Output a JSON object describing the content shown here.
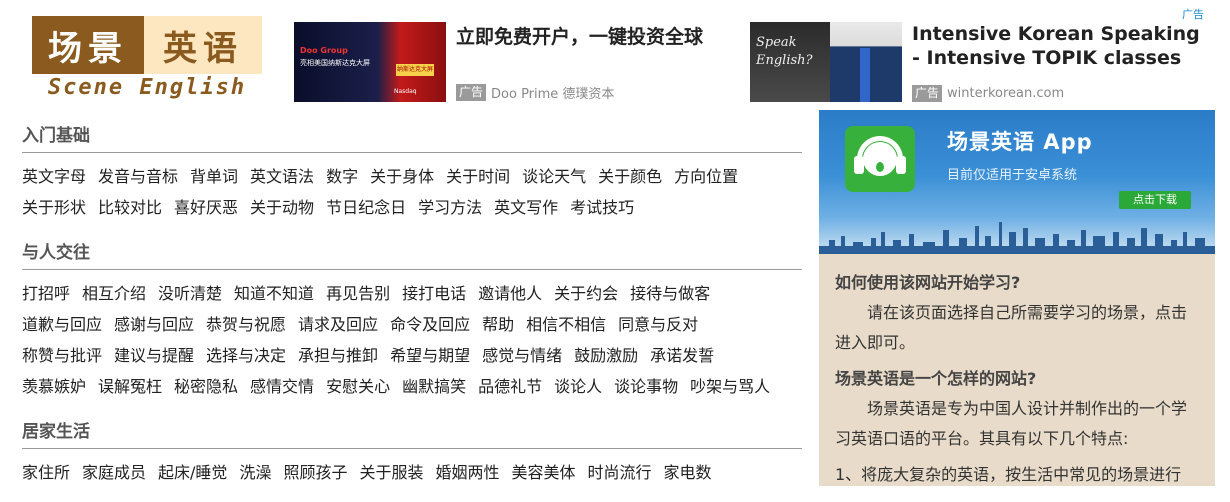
{
  "logo": {
    "cn_part1": "场景",
    "cn_part2": "英语",
    "en": "Scene English"
  },
  "ads": {
    "mark": "广告",
    "ad1": {
      "title": "立即免费开户，一键投资全球",
      "badge": "广告",
      "source": "Doo Prime 德璞资本",
      "img_line1": "Doo Group",
      "img_line2": "亮相美国纳斯达克大屏",
      "img_tag": "纳斯达克大屏",
      "img_brand": "Nasdaq"
    },
    "ad2": {
      "title": "Intensive Korean Speaking - Intensive TOPIK classes",
      "badge": "广告",
      "source": "winterkorean.com",
      "img_text1": "Speak",
      "img_text2": "English?"
    }
  },
  "sections": [
    {
      "title": "入门基础",
      "links": [
        "英文字母",
        "发音与音标",
        "背单词",
        "英文语法",
        "数字",
        "关于身体",
        "关于时间",
        "谈论天气",
        "关于颜色",
        "方向位置",
        "关于形状",
        "比较对比",
        "喜好厌恶",
        "关于动物",
        "节日纪念日",
        "学习方法",
        "英文写作",
        "考试技巧"
      ]
    },
    {
      "title": "与人交往",
      "links": [
        "打招呼",
        "相互介绍",
        "没听清楚",
        "知道不知道",
        "再见告别",
        "接打电话",
        "邀请他人",
        "关于约会",
        "接待与做客",
        "道歉与回应",
        "感谢与回应",
        "恭贺与祝愿",
        "请求及回应",
        "命令及回应",
        "帮助",
        "相信不相信",
        "同意与反对",
        "称赞与批评",
        "建议与提醒",
        "选择与决定",
        "承担与推卸",
        "希望与期望",
        "感觉与情绪",
        "鼓励激励",
        "承诺发誓",
        "羡慕嫉妒",
        "误解冤枉",
        "秘密隐私",
        "感情交情",
        "安慰关心",
        "幽默搞笑",
        "品德礼节",
        "谈论人",
        "谈论事物",
        "吵架与骂人"
      ]
    },
    {
      "title": "居家生活",
      "links": [
        "家住所",
        "家庭成员",
        "起床/睡觉",
        "洗澡",
        "照顾孩子",
        "关于服装",
        "婚姻两性",
        "美容美体",
        "时尚流行",
        "家电数"
      ]
    }
  ],
  "sidebar": {
    "banner_title": "场景英语 App",
    "banner_sub": "目前仅适用于安卓系统",
    "download": "点击下载",
    "q1": "如何使用该网站开始学习?",
    "a1": "请在该页面选择自己所需要学习的场景，点击进入即可。",
    "q2": "场景英语是一个怎样的网站?",
    "a2": "场景英语是专为中国人设计并制作出的一个学习英语口语的平台。其具有以下几个特点:",
    "a3": "1、将庞大复杂的英语，按生活中常见的场景进行"
  }
}
